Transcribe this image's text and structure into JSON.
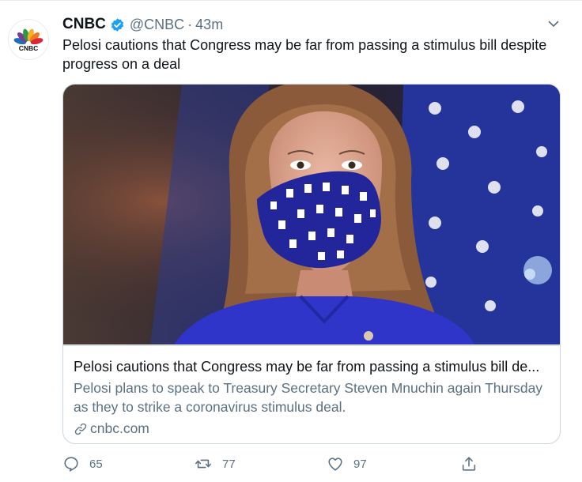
{
  "tweet": {
    "author_name": "CNBC",
    "handle": "@CNBC",
    "separator": "·",
    "time": "43m",
    "text": "Pelosi cautions that Congress may be far from passing a stimulus bill despite progress on a deal",
    "avatar_logo_text": "CNBC"
  },
  "card": {
    "title": "Pelosi cautions that Congress may be far from passing a stimulus bill de...",
    "description": "Pelosi plans to speak to Treasury Secretary Steven Mnuchin again Thursday as they to strike a coronavirus stimulus deal.",
    "domain": "cnbc.com"
  },
  "actions": {
    "replies": "65",
    "retweets": "77",
    "likes": "97"
  },
  "colors": {
    "accent": "#1da1f2",
    "secondary_text": "#5b7083",
    "border": "#ccd6dd"
  },
  "icons": [
    "verified-badge-icon",
    "chevron-down-icon",
    "link-icon",
    "reply-icon",
    "retweet-icon",
    "like-icon",
    "share-icon"
  ]
}
